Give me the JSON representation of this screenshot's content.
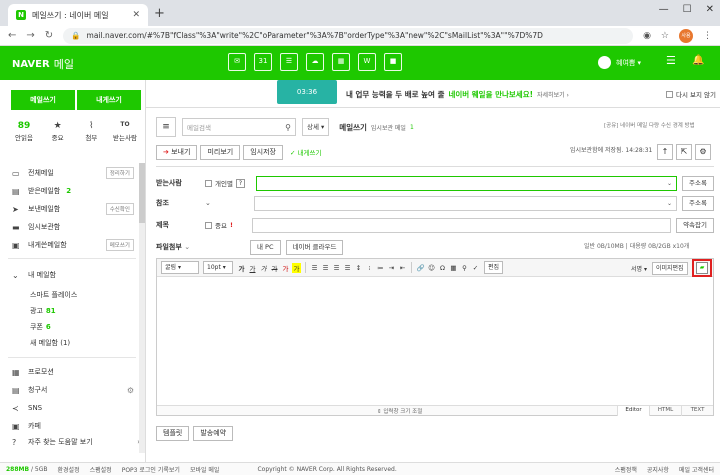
{
  "browser": {
    "tab_title": "메일쓰기 : 네이버 메일",
    "tab_favicon": "N",
    "url": "mail.naver.com/#%7B\"fClass\"%3A\"write\"%2C\"oParameter\"%3A%7B\"orderType\"%3A\"new\"%2C\"sMailList\"%3A\"\"%7D%7D",
    "profile_label": "사용"
  },
  "header": {
    "logo": "NAVER",
    "service": "메일",
    "app_icons": [
      "mail-app-icon",
      "calendar-app-icon",
      "contacts-app-icon",
      "cloud-app-icon",
      "memo-app-icon",
      "office-app-icon",
      "note-app-icon"
    ],
    "calendar_day": "31",
    "user": "혜여쁨 ▾"
  },
  "sidebar": {
    "write_label": "메일쓰기",
    "self_write_label": "내게쓰기",
    "quick": [
      {
        "count": "89",
        "label": "안읽음"
      },
      {
        "icon": "★",
        "label": "중요"
      },
      {
        "icon": "📎",
        "label": "첨부"
      },
      {
        "icon": "TO",
        "label": "받는사람"
      }
    ],
    "folders": [
      {
        "label": "전체메일",
        "tag": "정리하기"
      },
      {
        "label": "받은메일함",
        "count": "2"
      },
      {
        "label": "보낸메일함",
        "tag": "수신확인"
      },
      {
        "label": "임시보관함"
      },
      {
        "label": "내게쓴메일함",
        "tag": "메모쓰기"
      }
    ],
    "my_folder_title": "내 메일함",
    "my_folders": [
      {
        "label": "스마트 플레이스"
      },
      {
        "label": "광고",
        "count": "81"
      },
      {
        "label": "쿠폰",
        "count": "6"
      },
      {
        "label": "새 메일함 (1)"
      }
    ],
    "extra": [
      {
        "label": "프로모션"
      },
      {
        "label": "청구서"
      },
      {
        "label": "SNS"
      },
      {
        "label": "카페"
      }
    ],
    "help": "자주 찾는 도움말 보기"
  },
  "statusbar": {
    "usage": "288MB",
    "quota": "/ 5GB",
    "items": [
      "환경설정",
      "스팸설정",
      "POP3 로그인 기록보기",
      "모바일 메일"
    ],
    "copyright": "Copyright © NAVER Corp. All Rights Reserved.",
    "right": [
      "스팸정책",
      "공지사항",
      "메일 고객센터"
    ]
  },
  "banner": {
    "image_time": "03:36",
    "text": "내 업무 능력을 두 배로 높여 줄",
    "highlight": "네이버 웨일을 만나보세요!",
    "more": "자세히보기 ›",
    "hide_today": "다시 보지 않기"
  },
  "toolbar": {
    "search_placeholder": "메일검색",
    "search_scope": "상세 ▾",
    "title": "메일쓰기",
    "draft_label": "임시보관 메일",
    "draft_count": "1",
    "notice": "[공유] 네이버 메일 다량 수신 경계 방법",
    "send": "보내기",
    "preview": "미리보기",
    "save_draft": "임시저장",
    "to_me": "내게쓰기",
    "autosave": "임시보관함에 저장됨. 14:28:31"
  },
  "form": {
    "to_label": "받는사람",
    "personal_label": "개인별",
    "cc_label": "참조",
    "subject_label": "제목",
    "important_label": "중요",
    "attach_label": "파일첨부",
    "address_book": "주소록",
    "signature_settings": "약속잡기",
    "my_pc": "내 PC",
    "cloud": "네이버 클라우드",
    "attach_info_normal": "일반 0B/10MB",
    "attach_info_bulk": "대용량 0B/2GB x10개"
  },
  "editor": {
    "font": "굴림",
    "size": "10pt",
    "html_btn": "편집",
    "sign": "서명 ▾",
    "image_editor": "이미지편집",
    "resize_hint": "⇕ 입력창 크기 조절",
    "modes": [
      "Editor",
      "HTML",
      "TEXT"
    ]
  },
  "bottom": {
    "template": "템플릿",
    "schedule": "발송예약"
  }
}
